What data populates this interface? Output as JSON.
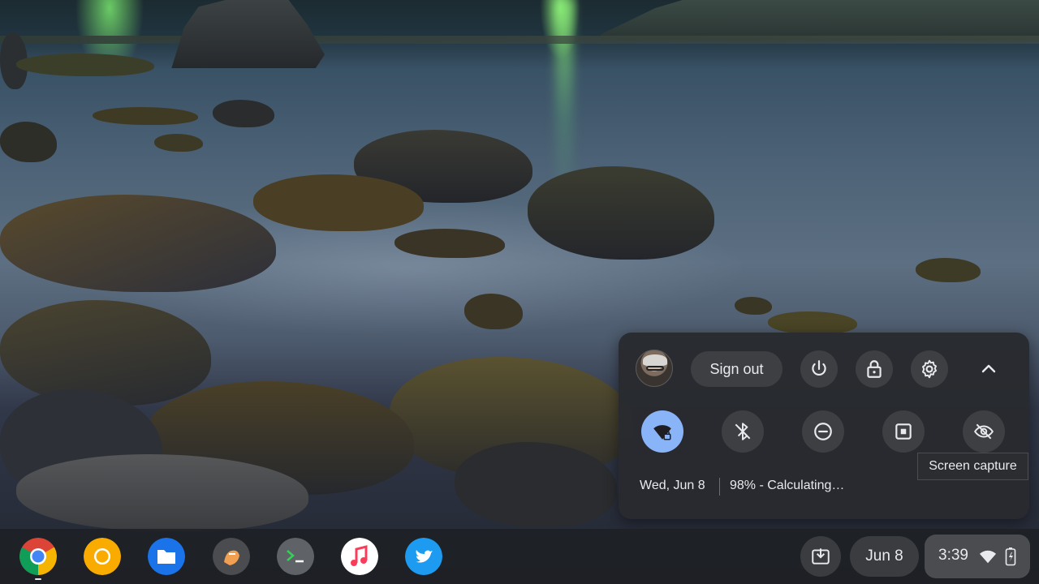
{
  "quick_settings": {
    "sign_out_label": "Sign out",
    "date": "Wed, Jun 8",
    "battery_status": "98% - Calculating…",
    "tiles": [
      {
        "name": "wifi",
        "active": true
      },
      {
        "name": "bluetooth",
        "active": false
      },
      {
        "name": "do-not-disturb",
        "active": false
      },
      {
        "name": "screen-capture",
        "active": false
      },
      {
        "name": "privacy-screen",
        "active": false
      }
    ]
  },
  "tooltip": {
    "text": "Screen capture"
  },
  "shelf": {
    "apps": [
      "chrome",
      "chrome-canary",
      "files",
      "paint",
      "terminal",
      "music",
      "twitter"
    ],
    "date_pill": "Jun 8",
    "time": "3:39"
  },
  "colors": {
    "panel_bg": "#28292e",
    "button_bg": "#3d3f43",
    "accent_active": "#8ab4f8",
    "text": "#e8eaed"
  }
}
